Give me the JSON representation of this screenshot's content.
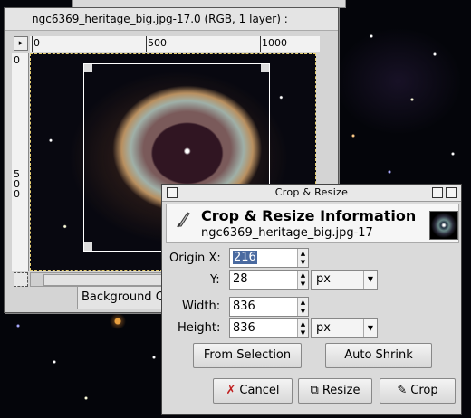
{
  "image_window": {
    "title": "ngc6369_heritage_big.jpg-17.0 (RGB, 1 layer) :",
    "ruler_h_labels": [
      "0",
      "500",
      "1000"
    ],
    "ruler_v_labels": [
      "0",
      "5",
      "0",
      "0"
    ],
    "status_layer": "Background C"
  },
  "dialog": {
    "window_title": "Crop & Resize",
    "header_title": "Crop & Resize Information",
    "header_subtitle": "ngc6369_heritage_big.jpg-17",
    "origin_x_label": "Origin X:",
    "origin_x_value": "216",
    "y_label": "Y:",
    "y_value": "28",
    "origin_unit": "px",
    "width_label": "Width:",
    "width_value": "836",
    "height_label": "Height:",
    "height_value": "836",
    "size_unit": "px",
    "from_selection_label": "From Selection",
    "auto_shrink_label": "Auto Shrink",
    "cancel_label": "Cancel",
    "resize_label": "Resize",
    "crop_label": "Crop"
  }
}
